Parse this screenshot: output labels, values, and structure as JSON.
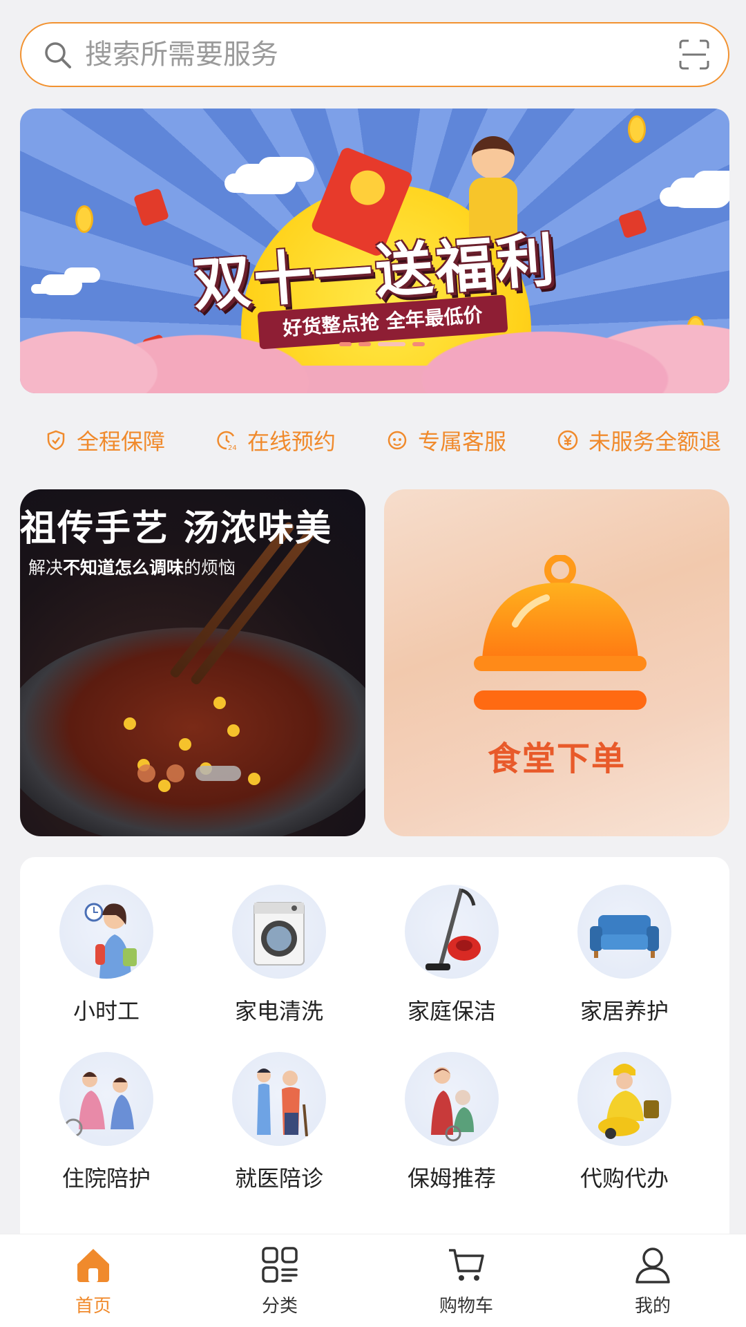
{
  "search": {
    "placeholder": "搜索所需要服务"
  },
  "banner": {
    "title": "双十一送福利",
    "subtitle": "好货整点抢 全年最低价"
  },
  "features": [
    {
      "label": "全程保障",
      "icon": "shield-check-icon"
    },
    {
      "label": "在线预约",
      "icon": "clock-24-icon"
    },
    {
      "label": "专属客服",
      "icon": "service-face-icon"
    },
    {
      "label": "未服务全额退",
      "icon": "yen-circle-icon"
    }
  ],
  "promo_left": {
    "title": "祖传手艺 汤浓味美",
    "subtitle_pre": "解决",
    "subtitle_bold": "不知道怎么调味",
    "subtitle_post": "的烦恼"
  },
  "promo_right": {
    "label": "食堂下单",
    "icon": "cloche-icon"
  },
  "services": [
    {
      "label": "小时工",
      "icon": "cleaner-woman-icon"
    },
    {
      "label": "家电清洗",
      "icon": "washing-machine-icon"
    },
    {
      "label": "家庭保洁",
      "icon": "vacuum-cleaner-icon"
    },
    {
      "label": "家居养护",
      "icon": "sofa-icon"
    },
    {
      "label": "住院陪护",
      "icon": "hospital-care-icon"
    },
    {
      "label": "就医陪诊",
      "icon": "medical-escort-icon"
    },
    {
      "label": "保姆推荐",
      "icon": "nanny-icon"
    },
    {
      "label": "代购代办",
      "icon": "delivery-rider-icon"
    }
  ],
  "tabs": [
    {
      "label": "首页",
      "icon": "home-icon",
      "active": true
    },
    {
      "label": "分类",
      "icon": "category-icon",
      "active": false
    },
    {
      "label": "购物车",
      "icon": "cart-icon",
      "active": false
    },
    {
      "label": "我的",
      "icon": "user-icon",
      "active": false
    }
  ],
  "colors": {
    "accent": "#f08a2c",
    "background": "#f1f1f3"
  }
}
